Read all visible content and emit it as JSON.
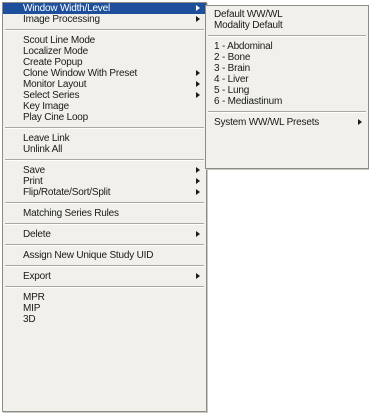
{
  "main_menu": {
    "groups": [
      [
        "Window Width/Level",
        "Image Processing"
      ],
      [
        "Scout Line Mode",
        "Localizer Mode",
        "Create Popup",
        "Clone Window With Preset",
        "Monitor Layout",
        "Select Series",
        "Key Image",
        "Play Cine Loop"
      ],
      [
        "Leave Link",
        "Unlink All"
      ],
      [
        "Save",
        "Print",
        "Flip/Rotate/Sort/Split"
      ],
      [
        "Matching Series Rules"
      ],
      [
        "Delete"
      ],
      [
        "Assign New Unique Study UID"
      ],
      [
        "Export"
      ],
      [
        "MPR",
        "MIP",
        "3D"
      ]
    ]
  },
  "sub_menu": {
    "groups": [
      [
        "Default WW/WL",
        "Modality Default"
      ],
      [
        "1 - Abdominal",
        "2 - Bone",
        "3 - Brain",
        "4 - Liver",
        "5 - Lung",
        "6 - Mediastinum"
      ],
      [
        "System WW/WL Presets"
      ]
    ]
  }
}
